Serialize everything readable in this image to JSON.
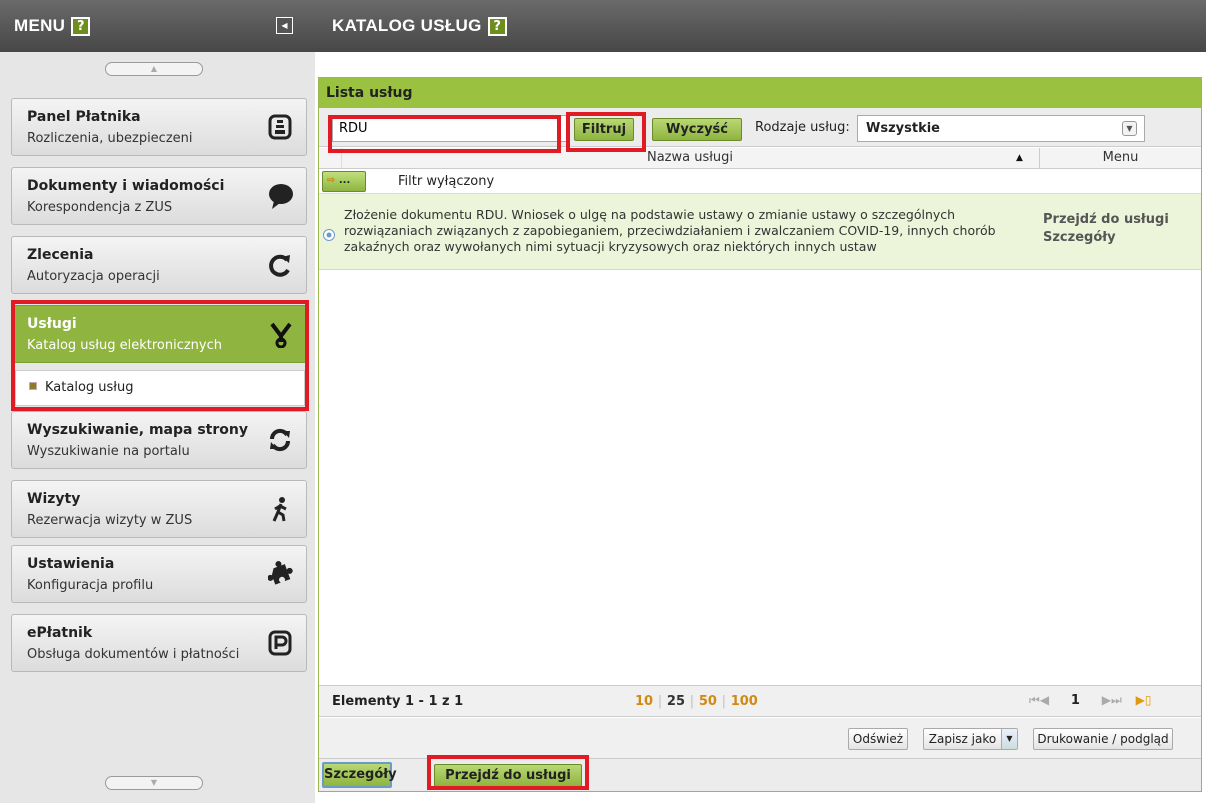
{
  "sidebar": {
    "title": "MENU",
    "help": "?",
    "collapse_icon": "collapse-left-icon",
    "scroll_up": "▲",
    "scroll_down": "▼",
    "items": [
      {
        "title": "Panel Płatnika",
        "subtitle": "Rozliczenia, ubezpieczeni",
        "icon": "payer-panel-icon"
      },
      {
        "title": "Dokumenty i wiadomości",
        "subtitle": "Korespondencja z ZUS",
        "icon": "speech-bubble-icon"
      },
      {
        "title": "Zlecenia",
        "subtitle": "Autoryzacja operacji",
        "icon": "refresh-icon"
      },
      {
        "title": "Usługi",
        "subtitle": "Katalog usług elektronicznych",
        "icon": "services-icon"
      },
      {
        "title": "Wyszukiwanie, mapa strony",
        "subtitle": "Wyszukiwanie na portalu",
        "icon": "sync-icon"
      },
      {
        "title": "Wizyty",
        "subtitle": "Rezerwacja wizyty w ZUS",
        "icon": "walking-person-icon"
      },
      {
        "title": "Ustawienia",
        "subtitle": "Konfiguracja profilu",
        "icon": "puzzle-icon"
      },
      {
        "title": "ePłatnik",
        "subtitle": "Obsługa dokumentów i płatności",
        "icon": "epayer-icon"
      }
    ],
    "submenu": {
      "label": "Katalog usług"
    }
  },
  "main": {
    "title": "KATALOG USŁUG",
    "help": "?",
    "panel_title": "Lista usług",
    "filter": {
      "search_value": "RDU",
      "filter_button": "Filtruj",
      "clear_button": "Wyczyść",
      "types_label": "Rodzaje usług:",
      "types_value": "Wszystkie"
    },
    "columns": {
      "name": "Nazwa usługi",
      "menu": "Menu"
    },
    "filter_toggle_label": "...",
    "filter_status": "Filtr wyłączony",
    "row": {
      "text": "Złożenie dokumentu RDU. Wniosek o ulgę na podstawie ustawy o zmianie ustawy o szczególnych rozwiązaniach związanych z zapobieganiem, przeciwdziałaniem i zwalczaniem COVID-19, innych chorób zakaźnych oraz wywołanych nimi sytuacji kryzysowych oraz niektórych innych ustaw",
      "link_go": "Przejdź do usługi",
      "link_details": "Szczegóły"
    },
    "paging": {
      "elements": "Elementy 1 - 1 z 1",
      "page_sizes": [
        "10",
        "25",
        "50",
        "100"
      ],
      "current_size": "25",
      "first": "⏮",
      "prev": "◀",
      "page": "1",
      "next": "▶",
      "last": "⏭",
      "export_icon": "export-icon"
    },
    "actions": {
      "refresh": "Odśwież",
      "save_as": "Zapisz jako",
      "print": "Drukowanie / podgląd"
    },
    "bottom": {
      "details": "Szczegóły",
      "go_to_service": "Przejdź do usługi"
    }
  }
}
